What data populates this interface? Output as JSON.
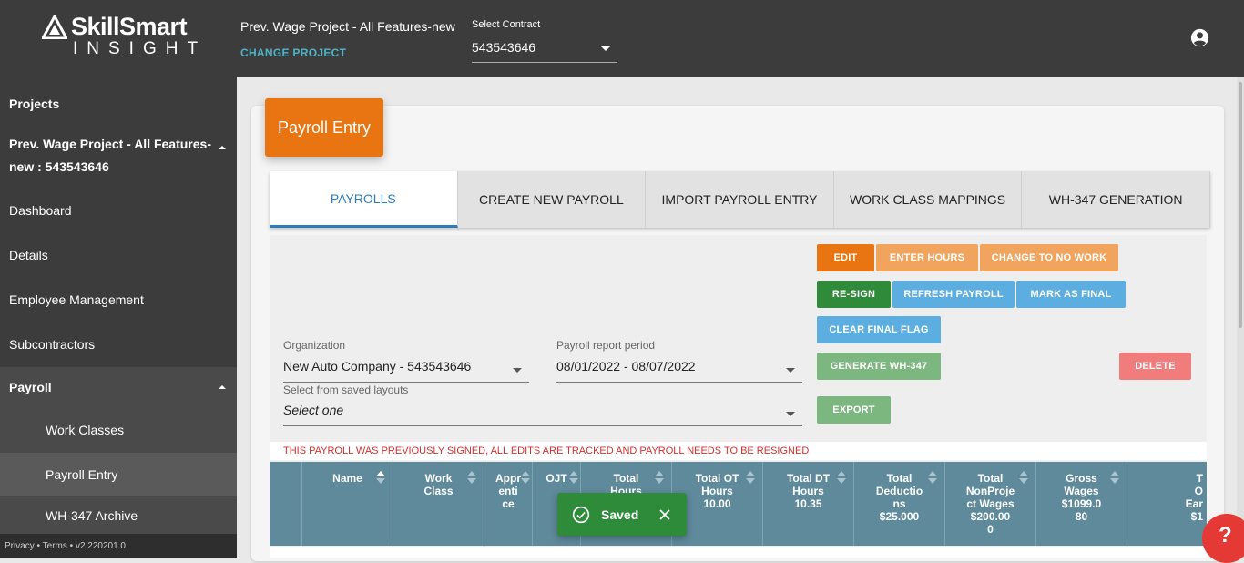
{
  "header": {
    "logo_top": "SkillSmart",
    "logo_bottom": "INSIGHT",
    "project_title": "Prev. Wage Project - All Features-new",
    "change_project": "CHANGE PROJECT",
    "contract_label": "Select Contract",
    "contract_value": "543543646",
    "user_icon": "account-circle-icon"
  },
  "sidebar": {
    "projects": "Projects",
    "project_name_1": "Prev. Wage Project - All Features-",
    "project_name_2": "new : 543543646",
    "dashboard": "Dashboard",
    "details": "Details",
    "employee_management": "Employee Management",
    "subcontractors": "Subcontractors",
    "payroll": "Payroll",
    "work_classes": "Work Classes",
    "payroll_entry": "Payroll Entry",
    "wh347_archive": "WH-347 Archive",
    "footer": "Privacy • Terms • v2.220201.0"
  },
  "page": {
    "title": "Payroll Entry"
  },
  "tabs": [
    "PAYROLLS",
    "CREATE NEW PAYROLL",
    "IMPORT PAYROLL ENTRY",
    "WORK CLASS MAPPINGS",
    "WH-347 GENERATION"
  ],
  "buttons": {
    "edit": "EDIT",
    "enter_hours": "ENTER HOURS",
    "change_no_work": "CHANGE TO NO WORK",
    "resign": "RE-SIGN",
    "refresh": "REFRESH PAYROLL",
    "mark_final": "MARK AS FINAL",
    "clear_final": "CLEAR FINAL FLAG",
    "generate": "GENERATE WH-347",
    "delete": "DELETE",
    "export": "EXPORT"
  },
  "filters": {
    "org_label": "Organization",
    "org_value": "New Auto Company - 543543646",
    "period_label": "Payroll report period",
    "period_value": "08/01/2022 - 08/07/2022",
    "layout_label": "Select from saved layouts",
    "layout_value": "Select one"
  },
  "warning": "THIS PAYROLL WAS PREVIOUSLY SIGNED, ALL EDITS ARE TRACKED AND PAYROLL NEEDS TO BE RESIGNED",
  "table": {
    "columns": [
      {
        "l1": "Name",
        "l2": "",
        "l3": "",
        "l4": ""
      },
      {
        "l1": "Work",
        "l2": "Class",
        "l3": "",
        "l4": ""
      },
      {
        "l1": "Appr",
        "l2": "enti",
        "l3": "ce",
        "l4": ""
      },
      {
        "l1": "OJT",
        "l2": "",
        "l3": "",
        "l4": ""
      },
      {
        "l1": "Total",
        "l2": "Hours",
        "l3": "",
        "l4": ""
      },
      {
        "l1": "Total OT",
        "l2": "Hours",
        "l3": "10.00",
        "l4": ""
      },
      {
        "l1": "Total DT",
        "l2": "Hours",
        "l3": "10.35",
        "l4": ""
      },
      {
        "l1": "Total",
        "l2": "Deductio",
        "l3": "ns",
        "l4": "$25.000"
      },
      {
        "l1": "Total",
        "l2": "NonProje",
        "l3": "ct Wages",
        "l4": "$200.00"
      },
      {
        "l1": "Gross",
        "l2": "Wages",
        "l3": "$1099.0",
        "l4": "80"
      },
      {
        "l1": "T",
        "l2": "O",
        "l3": "Ear",
        "l4": "$1"
      }
    ],
    "col9_extra": "0"
  },
  "toast": {
    "message": "Saved"
  },
  "help": "?"
}
